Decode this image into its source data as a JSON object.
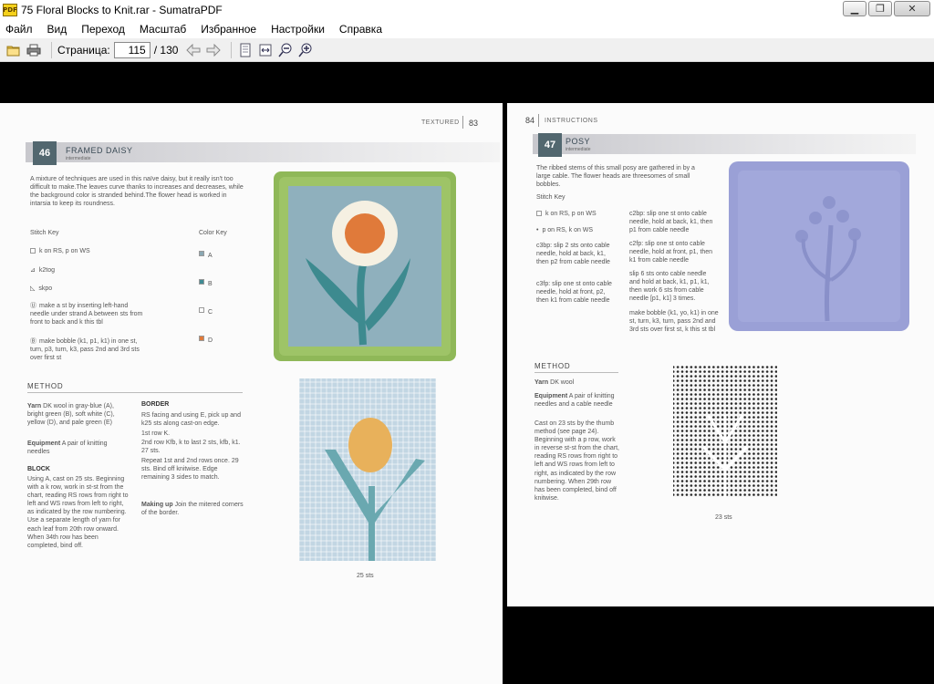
{
  "window": {
    "title": "75 Floral Blocks to Knit.rar - SumatraPDF",
    "app_icon_text": "PDF",
    "minimize": "▁",
    "maximize": "❐",
    "close": "✕"
  },
  "menu": [
    "Файл",
    "Вид",
    "Переход",
    "Масштаб",
    "Избранное",
    "Настройки",
    "Справка"
  ],
  "toolbar": {
    "page_label": "Страница:",
    "page_value": "115",
    "page_total": "/ 130",
    "icons": [
      "open-icon",
      "print-icon",
      "back-arrow-icon",
      "forward-arrow-icon",
      "fit-page-icon",
      "fit-width-icon",
      "zoom-out-icon",
      "zoom-in-icon"
    ]
  },
  "left_page": {
    "section": "TEXTURED",
    "page_number": "83",
    "block_number": "46",
    "block_title": "FRAMED DAISY",
    "level": "intermediate",
    "intro": "A mixture of techniques are used in this naïve daisy, but it really isn't too difficult to make.The leaves curve thanks to increases and decreases, while the background color is stranded behind.The flower head is worked in intarsia to keep its roundness.",
    "stitch_key_title": "Stitch Key",
    "color_key_title": "Color Key",
    "stitch_key": [
      "k on RS, p on WS",
      "k2tog",
      "skpo",
      "make a st by inserting left-hand needle under strand A between sts from front to back and k this tbl",
      "make bobble (k1, p1, k1) in one st, turn, p3, turn, k3, pass 2nd and 3rd sts over first st"
    ],
    "color_key": [
      {
        "label": "A",
        "color": "#8aa7b2"
      },
      {
        "label": "B",
        "color": "#3f8b93"
      },
      {
        "label": "C",
        "color": "#ffffff"
      },
      {
        "label": "D",
        "color": "#e07a3a"
      }
    ],
    "method_title": "METHOD",
    "yarn_label": "Yarn",
    "yarn": "DK wool in gray-blue (A), bright green (B), soft white (C), yellow (D), and pale green (E)",
    "equipment_label": "Equipment",
    "equipment": "A pair of knitting needles",
    "block_title_h": "BLOCK",
    "block_text": "Using A, cast on 25 sts. Beginning with a k row, work in st-st from the chart, reading RS rows from right to left and WS rows from left to right, as indicated by the row numbering. Use a separate length of yarn for each leaf from 20th row onward. When 34th row has been completed, bind off.",
    "border_title": "BORDER",
    "border_text1": "RS facing and using E, pick up and k25 sts along cast-on edge.",
    "border_row1": "1st row K.",
    "border_row2": "2nd row Kfb, k to last 2 sts, kfb, k1. 27 sts.",
    "border_text2": "Repeat 1st and 2nd rows once. 29 sts. Bind off knitwise. Edge remaining 3 sides to match.",
    "making_up_label": "Making up",
    "making_up": "Join the mitered corners of the border.",
    "chart_caption": "25 sts"
  },
  "right_page": {
    "page_number": "84",
    "section": "INSTRUCTIONS",
    "block_number": "47",
    "block_title": "POSY",
    "level": "intermediate",
    "intro": "The ribbed stems of this small posy are gathered in by a large cable. The flower heads are threesomes of small bobbles.",
    "stitch_key_title": "Stitch Key",
    "stitch_key_left": [
      "k on RS, p on WS",
      "p on RS, k on WS",
      "c3bp: slip 2 sts onto cable needle, hold at back, k1, then p2 from cable needle",
      "c3fp: slip one st onto cable needle, hold at front, p2, then k1 from cable needle"
    ],
    "stitch_key_right": [
      "c2bp: slip one st onto cable needle, hold at back, k1, then p1 from cable needle",
      "c2fp: slip one st onto cable needle, hold at front, p1, then k1 from cable needle",
      "slip 6 sts onto cable needle and hold at back, k1, p1, k1, then work 6 sts from cable needle [p1, k1] 3 times.",
      "make bobble (k1, yo, k1) in one st, turn, k3, turn, pass 2nd and 3rd sts over first st, k this st tbl"
    ],
    "method_title": "METHOD",
    "yarn_label": "Yarn",
    "yarn": "DK wool",
    "equipment_label": "Equipment",
    "equipment": "A pair of knitting needles and a cable needle",
    "method_text": "Cast on 23 sts by the thumb method (see page 24). Beginning with a p row, work in reverse st-st from the chart, reading RS rows from right to left and WS rows from left to right, as indicated by the row numbering. When 29th row has been completed, bind off knitwise.",
    "chart_caption": "23 sts"
  }
}
